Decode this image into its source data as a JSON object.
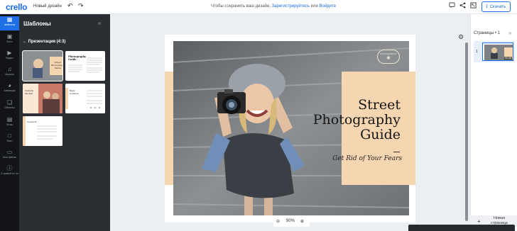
{
  "topbar": {
    "logo": "crello",
    "design_name": "Новый дизайн",
    "undo_icon": "undo-icon",
    "redo_icon": "redo-icon",
    "save_note": "Чтобы сохранить ваш дизайн,",
    "register_link": "Зарегистрируйтесь",
    "or": "или",
    "login_link": "Войдите",
    "download_label": "Скачать",
    "icons": [
      "comment-icon",
      "share-icon",
      "resize-icon"
    ]
  },
  "nav": {
    "items": [
      {
        "label": "Шаблоны",
        "icon": "templates-icon"
      },
      {
        "label": "Фото",
        "icon": "photo-icon"
      },
      {
        "label": "Видео",
        "icon": "video-icon"
      },
      {
        "label": "Музыка",
        "icon": "music-icon"
      },
      {
        "label": "Анимация",
        "icon": "animation-icon"
      },
      {
        "label": "Объекты",
        "icon": "objects-icon"
      },
      {
        "label": "Фоны",
        "icon": "backgrounds-icon"
      },
      {
        "label": "Текст",
        "icon": "text-icon"
      },
      {
        "label": "Мои файлы",
        "icon": "folder-icon"
      },
      {
        "label": "О правой кл. кн",
        "icon": "help-icon"
      }
    ]
  },
  "panel": {
    "title": "Шаблоны",
    "back_label": "Презентация (4:3)",
    "templates": [
      {
        "title": "Street Photography Guide"
      },
      {
        "title": "Photography Guide"
      },
      {
        "title": "Camera Models"
      },
      {
        "title": "Basic Combos"
      },
      {
        "title": "Contacts"
      }
    ]
  },
  "slide": {
    "title_line1": "Street",
    "title_line2": "Photography",
    "title_line3": "Guide",
    "subtitle": "Get Rid of Your Fears",
    "stamp_text": "PHOTOGRAPHY",
    "colors": {
      "peach": "#f6d6b1",
      "accent": "#1e6ee6"
    }
  },
  "zoom": {
    "value": "90%"
  },
  "pages": {
    "title": "Страницы • 1",
    "page_number": "1",
    "duration": "00:05",
    "new_page_label": "Новая страница"
  }
}
